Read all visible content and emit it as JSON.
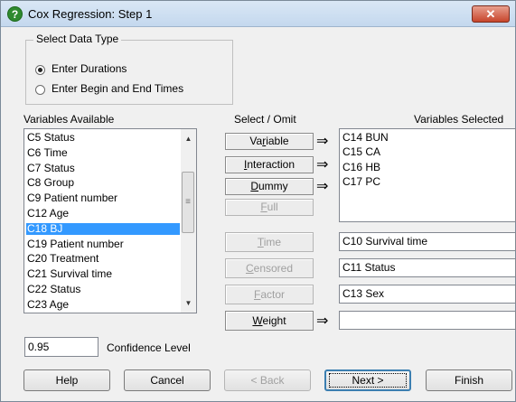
{
  "window": {
    "title": "Cox Regression: Step 1",
    "close_label": "✕"
  },
  "data_type": {
    "group_label": "Select Data Type",
    "options": [
      {
        "label": "Enter Durations",
        "checked": true
      },
      {
        "label": "Enter Begin and End Times",
        "checked": false
      }
    ]
  },
  "variables_available": {
    "label": "Variables Available",
    "items": [
      "C5 Status",
      "C6 Time",
      "C7 Status",
      "C8 Group",
      "C9 Patient number",
      "C12 Age",
      "C18 BJ",
      "C19 Patient number",
      "C20 Treatment",
      "C21 Survival time",
      "C22 Status",
      "C23 Age"
    ],
    "selected": "C18 BJ"
  },
  "select_omit": {
    "label": "Select / Omit",
    "buttons": [
      {
        "pre": "Va",
        "u": "r",
        "post": "iable",
        "enabled": true
      },
      {
        "pre": "",
        "u": "I",
        "post": "nteraction",
        "enabled": true
      },
      {
        "pre": "",
        "u": "D",
        "post": "ummy",
        "enabled": true
      },
      {
        "pre": "",
        "u": "F",
        "post": "ull",
        "enabled": false
      }
    ]
  },
  "variables_selected": {
    "label": "Variables Selected",
    "items": [
      "C14 BUN",
      "C15 CA",
      "C16 HB",
      "C17 PC"
    ]
  },
  "assignments": [
    {
      "pre": "",
      "u": "T",
      "post": "ime",
      "enabled": false,
      "value": "C10 Survival time"
    },
    {
      "pre": "",
      "u": "C",
      "post": "ensored",
      "enabled": false,
      "value": "C11 Status"
    },
    {
      "pre": "",
      "u": "F",
      "post": "actor",
      "enabled": false,
      "value": "C13 Sex"
    },
    {
      "pre": "",
      "u": "W",
      "post": "eight",
      "enabled": true,
      "value": ""
    }
  ],
  "confidence": {
    "value": "0.95",
    "label": "Confidence Level"
  },
  "footer_buttons": [
    {
      "pre": "",
      "u": "H",
      "post": "elp",
      "enabled": true
    },
    {
      "pre": "",
      "u": "C",
      "post": "ancel",
      "enabled": true
    },
    {
      "pre": "< ",
      "u": "B",
      "post": "ack",
      "enabled": false
    },
    {
      "pre": "Next ",
      "u": ">",
      "post": "",
      "enabled": true
    },
    {
      "pre": "",
      "u": "F",
      "post": "inish",
      "enabled": true
    }
  ],
  "arrow_glyph": "⇒"
}
